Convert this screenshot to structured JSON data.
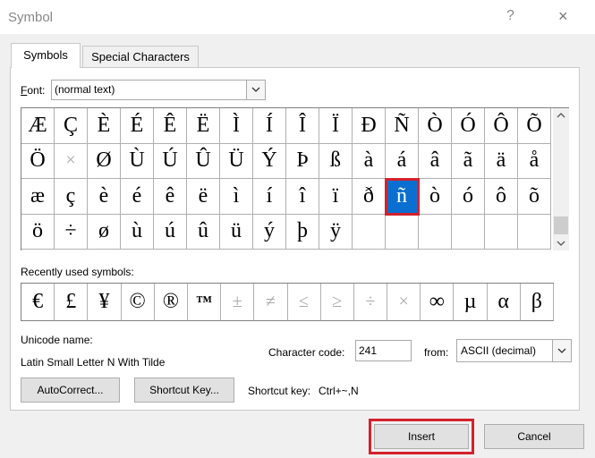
{
  "window": {
    "title": "Symbol",
    "help_label": "?",
    "close_label": "×"
  },
  "tabs": [
    {
      "label": "Symbols",
      "active": true
    },
    {
      "label": "Special Characters",
      "active": false
    }
  ],
  "font": {
    "label": "Font:",
    "value": "(normal text)"
  },
  "symbol_grid": {
    "rows": [
      [
        "Æ",
        "Ç",
        "È",
        "É",
        "Ê",
        "Ë",
        "Ì",
        "Í",
        "Î",
        "Ï",
        "Ð",
        "Ñ",
        "Ò",
        "Ó",
        "Ô",
        "Õ"
      ],
      [
        "Ö",
        "×",
        "Ø",
        "Ù",
        "Ú",
        "Û",
        "Ü",
        "Ý",
        "Þ",
        "ß",
        "à",
        "á",
        "â",
        "ã",
        "ä",
        "å"
      ],
      [
        "æ",
        "ç",
        "è",
        "é",
        "ê",
        "ë",
        "ì",
        "í",
        "î",
        "ï",
        "ð",
        "ñ",
        "ò",
        "ó",
        "ô",
        "õ"
      ],
      [
        "ö",
        "÷",
        "ø",
        "ù",
        "ú",
        "û",
        "ü",
        "ý",
        "þ",
        "ÿ",
        "",
        "",
        "",
        "",
        "",
        ""
      ]
    ],
    "selected": "ñ"
  },
  "recent": {
    "label": "Recently used symbols:",
    "symbols": [
      "€",
      "£",
      "¥",
      "©",
      "®",
      "™",
      "±",
      "≠",
      "≤",
      "≥",
      "÷",
      "×",
      "∞",
      "µ",
      "α",
      "β"
    ]
  },
  "unicode": {
    "name_label": "Unicode name:",
    "name_value": "Latin Small Letter N With Tilde"
  },
  "char_code": {
    "label": "Character code:",
    "value": "241",
    "from_label": "from:",
    "from_value": "ASCII (decimal)"
  },
  "buttons": {
    "autocorrect": "AutoCorrect...",
    "shortcut_key": "Shortcut Key...",
    "insert": "Insert",
    "cancel": "Cancel"
  },
  "shortcut": {
    "label": "Shortcut key:",
    "value": "Ctrl+~,N"
  },
  "colors": {
    "selection": "#0a6fd0",
    "highlight": "#d3222d"
  }
}
